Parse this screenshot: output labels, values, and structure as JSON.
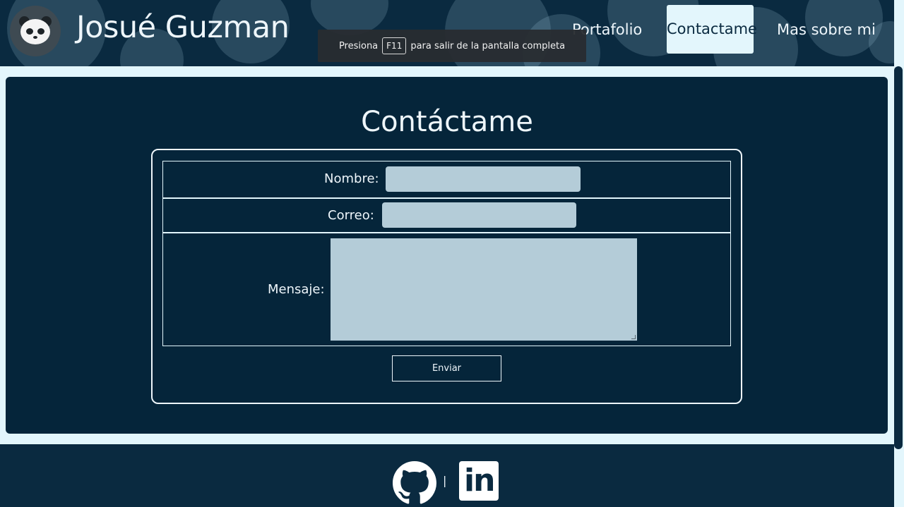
{
  "header": {
    "brand": "Josué Guzman",
    "nav": [
      {
        "label": "Portafolio"
      },
      {
        "label": "Contactame",
        "active": true
      },
      {
        "label": "Mas sobre mi"
      }
    ]
  },
  "toast": {
    "prefix": "Presiona",
    "key": "F11",
    "suffix": "para salir de la pantalla completa"
  },
  "contact": {
    "title": "Contáctame",
    "name_label": "Nombre:",
    "name_value": "",
    "email_label": "Correo:",
    "email_value": "",
    "message_label": "Mensaje:",
    "message_value": "",
    "submit_label": "Enviar"
  },
  "footer": {
    "separator": "|",
    "linkedin_text": "in",
    "icons": [
      "github-icon",
      "linkedin-icon"
    ]
  },
  "colors": {
    "dark_navy": "#05253a",
    "header_navy": "#0a2a40",
    "light_cyan": "#e3f6fc",
    "input_fill": "#b4ccd8"
  }
}
